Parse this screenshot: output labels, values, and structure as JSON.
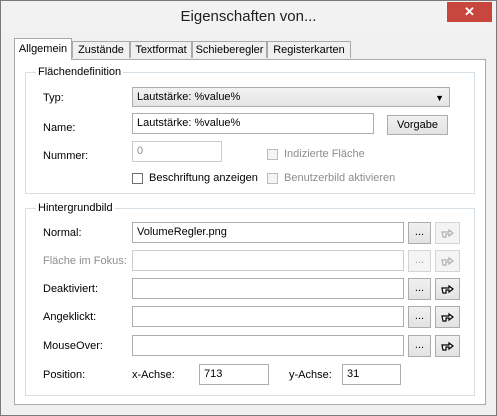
{
  "window": {
    "title": "Eigenschaften von...",
    "close_glyph": "✕"
  },
  "tabs": [
    {
      "label": "Allgemein",
      "active": true
    },
    {
      "label": "Zustände"
    },
    {
      "label": "Textformat"
    },
    {
      "label": "Schieberegler"
    },
    {
      "label": "Registerkarten"
    }
  ],
  "flaechendefinition": {
    "legend": "Flächendefinition",
    "typ_label": "Typ:",
    "typ_value": "Lautstärke: %value%",
    "name_label": "Name:",
    "name_value": "Lautstärke: %value%",
    "vorgabe_button": "Vorgabe",
    "nummer_label": "Nummer:",
    "nummer_value": "0",
    "indizierte_flaeche": "Indizierte Fläche",
    "beschriftung_anzeigen": "Beschriftung anzeigen",
    "benutzerbild_aktivieren": "Benutzerbild aktivieren"
  },
  "hintergrundbild": {
    "legend": "Hintergrundbild",
    "normal_label": "Normal:",
    "normal_value": "VolumeRegler.png",
    "fokus_label": "Fläche im Fokus:",
    "fokus_value": "",
    "deaktiviert_label": "Deaktiviert:",
    "deaktiviert_value": "",
    "angeklickt_label": "Angeklickt:",
    "angeklickt_value": "",
    "mouseover_label": "MouseOver:",
    "mouseover_value": "",
    "browse_label": "...",
    "position_label": "Position:",
    "x_label": "x-Achse:",
    "x_value": "713",
    "y_label": "y-Achse:",
    "y_value": "31"
  },
  "icons": {
    "pick": "hand-pointer-icon"
  }
}
